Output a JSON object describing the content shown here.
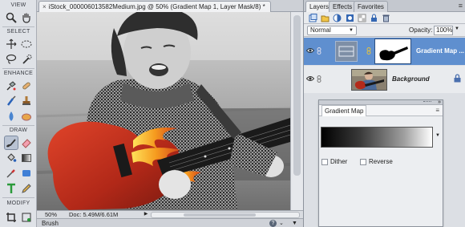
{
  "toolbox": {
    "sections": [
      "VIEW",
      "SELECT",
      "ENHANCE",
      "DRAW",
      "MODIFY"
    ],
    "tools": [
      "zoom-icon",
      "hand-icon",
      "move-icon",
      "marquee-icon",
      "lasso-icon",
      "quick-select-icon",
      "red-eye-icon",
      "spot-heal-icon",
      "smart-brush-icon",
      "clone-stamp-icon",
      "blur-icon",
      "sponge-icon",
      "brush-icon",
      "eraser-icon",
      "paint-bucket-icon",
      "gradient-icon",
      "color-picker-icon",
      "shape-icon",
      "type-icon",
      "pencil-icon",
      "crop-icon",
      "recompose-icon"
    ]
  },
  "document": {
    "tab_close": "×",
    "tab_title": "iStock_000006013582Medium.jpg @ 50% (Gradient Map 1, Layer Mask/8) *"
  },
  "status": {
    "zoom": "50%",
    "doc_size": "Doc: 5.49M/6.61M",
    "arrow": "▶"
  },
  "options_bar": {
    "tool_name": "Brush",
    "help": "?",
    "chevron": "⌄",
    "collapse": "▼"
  },
  "panels": {
    "tabs": [
      "Layers",
      "Effects",
      "Favorites"
    ],
    "menu": "≡",
    "blend_mode": "Normal",
    "opacity_label": "Opacity:",
    "opacity_value": "100%",
    "layers": [
      {
        "name": "Gradient Map ...",
        "selected": true
      },
      {
        "name": "Background",
        "selected": false
      }
    ]
  },
  "gradient_map": {
    "close": "»",
    "title": "Gradient Map",
    "menu": "≡",
    "dither_label": "Dither",
    "reverse_label": "Reverse",
    "dither_checked": false,
    "reverse_checked": false
  },
  "colors": {
    "selection": "#5f8fcf",
    "guitar_red": "#c0301c",
    "flame_orange": "#f0a020"
  }
}
